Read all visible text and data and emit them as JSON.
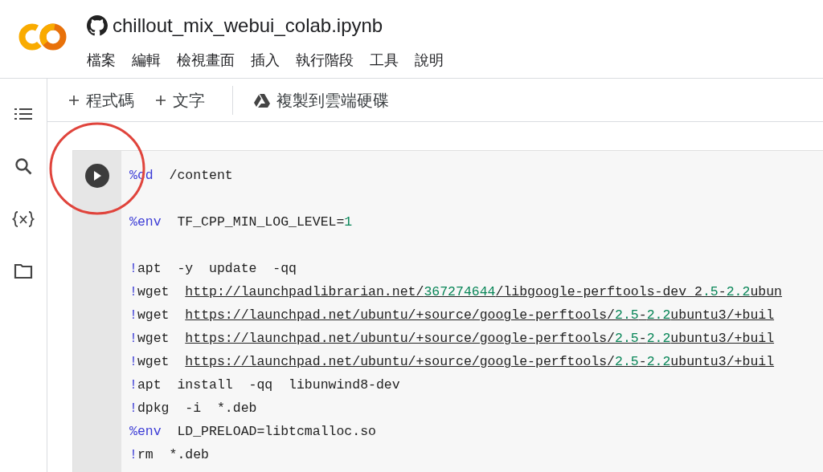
{
  "header": {
    "title": "chillout_mix_webui_colab.ipynb",
    "menu": [
      "檔案",
      "編輯",
      "檢視畫面",
      "插入",
      "執行階段",
      "工具",
      "說明"
    ]
  },
  "toolbar": {
    "buttons": [
      {
        "kind": "add",
        "label": "程式碼"
      },
      {
        "kind": "add",
        "label": "文字"
      },
      {
        "kind": "drive",
        "label": "複製到雲端硬碟"
      }
    ]
  },
  "cell": {
    "highlighted": true,
    "blocks": [
      [
        [
          {
            "kind": "magic",
            "text": "%cd"
          },
          {
            "kind": "plain",
            "text": "  /content"
          }
        ]
      ],
      [
        [
          {
            "kind": "magic",
            "text": "%env"
          },
          {
            "kind": "plain",
            "text": "  TF_CPP_MIN_LOG_LEVEL="
          },
          {
            "kind": "number",
            "text": "1"
          }
        ]
      ],
      [
        [
          {
            "kind": "magic",
            "text": "!"
          },
          {
            "kind": "plain",
            "text": "apt  -y  update  -qq"
          }
        ],
        [
          {
            "kind": "magic",
            "text": "!"
          },
          {
            "kind": "plain",
            "text": "wget  "
          },
          {
            "kind": "link",
            "text": "http://launchpadlibrarian.net/"
          },
          {
            "kind": "link_number",
            "text": "367274644"
          },
          {
            "kind": "link",
            "text": "/libgoogle-perftools-dev_2"
          },
          {
            "kind": "link_number",
            "text": ".5"
          },
          {
            "kind": "link",
            "text": "-"
          },
          {
            "kind": "link_number",
            "text": "2.2"
          },
          {
            "kind": "link",
            "text": "ubun"
          }
        ],
        [
          {
            "kind": "magic",
            "text": "!"
          },
          {
            "kind": "plain",
            "text": "wget  "
          },
          {
            "kind": "link",
            "text": "https://launchpad.net/ubuntu/+source/google-perftools/"
          },
          {
            "kind": "link_number",
            "text": "2.5"
          },
          {
            "kind": "link",
            "text": "-"
          },
          {
            "kind": "link_number",
            "text": "2.2"
          },
          {
            "kind": "link",
            "text": "ubuntu3/+buil"
          }
        ],
        [
          {
            "kind": "magic",
            "text": "!"
          },
          {
            "kind": "plain",
            "text": "wget  "
          },
          {
            "kind": "link",
            "text": "https://launchpad.net/ubuntu/+source/google-perftools/"
          },
          {
            "kind": "link_number",
            "text": "2.5"
          },
          {
            "kind": "link",
            "text": "-"
          },
          {
            "kind": "link_number",
            "text": "2.2"
          },
          {
            "kind": "link",
            "text": "ubuntu3/+buil"
          }
        ],
        [
          {
            "kind": "magic",
            "text": "!"
          },
          {
            "kind": "plain",
            "text": "wget  "
          },
          {
            "kind": "link",
            "text": "https://launchpad.net/ubuntu/+source/google-perftools/"
          },
          {
            "kind": "link_number",
            "text": "2.5"
          },
          {
            "kind": "link",
            "text": "-"
          },
          {
            "kind": "link_number",
            "text": "2.2"
          },
          {
            "kind": "link",
            "text": "ubuntu3/+buil"
          }
        ],
        [
          {
            "kind": "magic",
            "text": "!"
          },
          {
            "kind": "plain",
            "text": "apt  install  -qq  libunwind8-dev"
          }
        ],
        [
          {
            "kind": "magic",
            "text": "!"
          },
          {
            "kind": "plain",
            "text": "dpkg  -i  *.deb"
          }
        ],
        [
          {
            "kind": "magic",
            "text": "%env"
          },
          {
            "kind": "plain",
            "text": "  LD_PRELOAD=libtcmalloc.so"
          }
        ],
        [
          {
            "kind": "magic",
            "text": "!"
          },
          {
            "kind": "plain",
            "text": "rm  *.deb"
          }
        ]
      ]
    ]
  }
}
